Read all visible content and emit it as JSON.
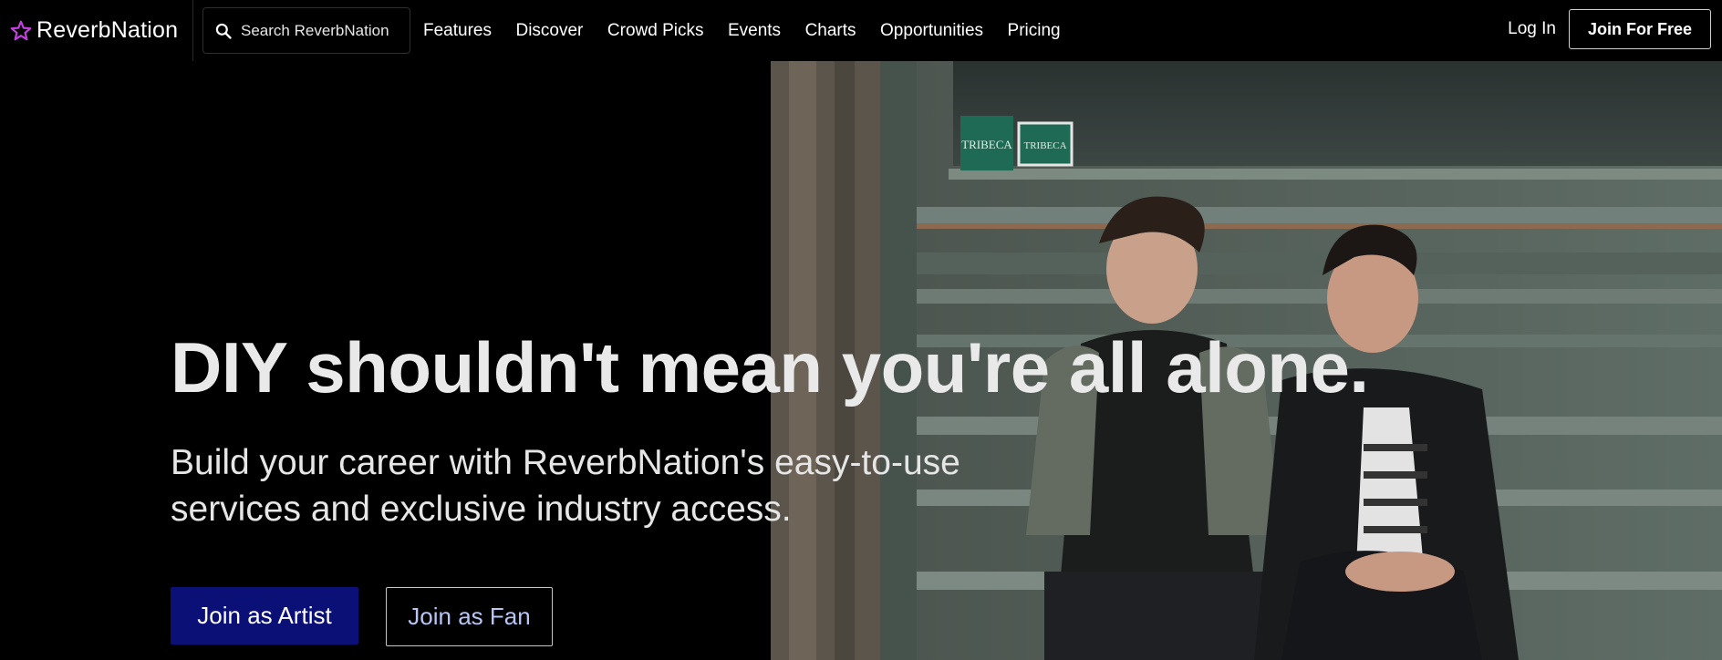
{
  "brand": {
    "name": "ReverbNation",
    "accent_color": "#c33fe0",
    "icon": "star-icon"
  },
  "search": {
    "placeholder": "Search ReverbNation",
    "icon": "search-icon"
  },
  "nav": {
    "items": [
      {
        "label": "Features"
      },
      {
        "label": "Discover"
      },
      {
        "label": "Crowd Picks"
      },
      {
        "label": "Events"
      },
      {
        "label": "Charts"
      },
      {
        "label": "Opportunities"
      },
      {
        "label": "Pricing"
      }
    ],
    "login_label": "Log In",
    "join_label": "Join For Free"
  },
  "hero": {
    "title": "DIY shouldn't mean you're all alone.",
    "subtitle_line1": "Build your career with ReverbNation's easy-to-use",
    "subtitle_line2": "services and exclusive industry access.",
    "primary_button": "Join as Artist",
    "secondary_button": "Join as Fan",
    "primary_color": "#0b1076",
    "sign_text_1": "TRIBECA",
    "sign_text_2": "TRIBECA"
  }
}
